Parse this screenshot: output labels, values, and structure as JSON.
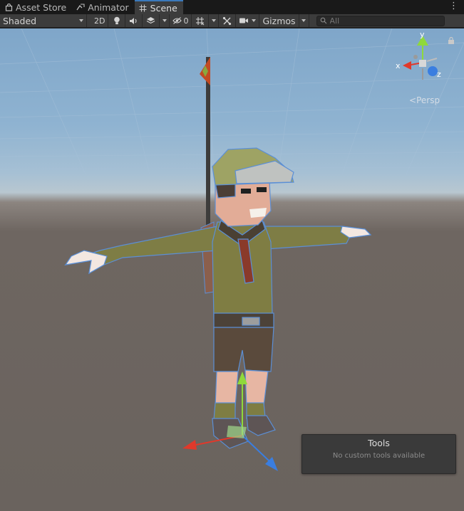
{
  "tabs": [
    {
      "label": "Asset Store",
      "icon": "shopping-bag-icon"
    },
    {
      "label": "Animator",
      "icon": "animator-icon"
    },
    {
      "label": "Scene",
      "icon": "grid-hash-icon"
    }
  ],
  "toolbar": {
    "shading_mode": "Shaded",
    "mode_2d": "2D",
    "hidden_count": "0",
    "gizmos_label": "Gizmos",
    "search_placeholder": "All"
  },
  "viewport": {
    "projection": "Persp",
    "axis_labels": {
      "x": "x",
      "y": "y",
      "z": "z"
    }
  },
  "tools_overlay": {
    "title": "Tools",
    "message": "No custom tools available"
  },
  "colors": {
    "active_tab_accent": "#3a79bb",
    "axis_x": "#e0392b",
    "axis_y": "#8fd93b",
    "axis_z": "#3a7ee0",
    "selection_outline": "#5b8fd6"
  }
}
